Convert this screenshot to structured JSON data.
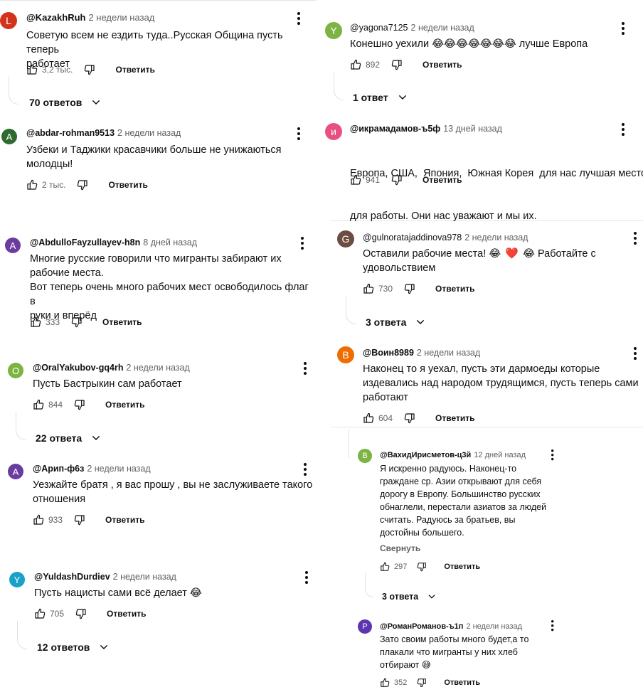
{
  "ui": {
    "reply_label": "Ответить",
    "collapse_label": "Свернуть"
  },
  "comments": [
    {
      "author": "@KazakhRuh",
      "time": "2 недели назад",
      "avatar": "L",
      "avatar_color": "#d2341b",
      "text_lines": [
        "Советую всем не ездить туда..Русская Община пусть теперь",
        "работает"
      ],
      "likes": "3,2 тыс.",
      "replies": "70 ответов"
    },
    {
      "author": "@abdar-rohman9513",
      "time": "2 недели назад",
      "avatar": "A",
      "avatar_color": "#2f6a31",
      "text_lines": [
        "Узбеки и Таджики красавчики больше не унижаються",
        "молодцы!"
      ],
      "likes": "2 тыс."
    },
    {
      "author": "@AbdulloFayzullayev-h8n",
      "time": "8 дней назад",
      "avatar": "A",
      "avatar_color": "#6a3ca0",
      "text_lines": [
        "Многие русские говорили что мигранты забирают их",
        "рабочие места.",
        "Вот теперь очень много рабочих мест освободилось флаг в",
        "руки и вперёд"
      ],
      "likes": "333"
    },
    {
      "author": "@OralYakubov-gq4rh",
      "time": "2 недели назад",
      "avatar": "O",
      "avatar_color": "#7cb342",
      "text_lines": [
        "Пусть Бастрыкин сам работает"
      ],
      "likes": "844",
      "replies": "22 ответа"
    },
    {
      "author": "@Арип-ф6з",
      "time": "2 недели назад",
      "avatar": "A",
      "avatar_color": "#6a3ca0",
      "text_lines": [
        "Уезжайте братя , я вас прошу , вы не заслуживаете такого",
        "отношения"
      ],
      "likes": "933"
    },
    {
      "author": "@YuldashDurdiev",
      "time": "2 недели назад",
      "avatar": "Y",
      "avatar_color": "#1aa1c7",
      "text_lines": [
        "Пусть нацисты сами всё делает"
      ],
      "emoji": [
        "😂"
      ],
      "likes": "705",
      "replies": "12 ответов"
    },
    {
      "author": "@yagona7125",
      "time": "2 недели назад",
      "avatar": "Y",
      "avatar_color": "#7cb342",
      "text_before_emoji": "Конешно уехили",
      "emoji": [
        "😂",
        "😂",
        "😂",
        "😂",
        "😂",
        "😂",
        "😂"
      ],
      "text_after_emoji": "лучше Европа",
      "likes": "892",
      "replies": "1 ответ"
    },
    {
      "author": "@икрамадамов-ъ5ф",
      "time": "13 дней назад",
      "avatar": "и",
      "avatar_color": "#e8517f",
      "text_lines": [
        "Европа, США,  Япония,  Южная Корея  для нас лучшая место",
        "для работы. Они нас уважают и мы их."
      ],
      "likes": "941"
    },
    {
      "author": "@gulnoratajaddinova978",
      "time": "2 недели назад",
      "avatar": "G",
      "avatar_color": "#6d4c41",
      "text_before_emoji": "Оставили рабочие места!",
      "emoji": [
        "😂",
        "❤️",
        "😂"
      ],
      "text_after_emoji": "Работайте с",
      "text_line2": "удовольствием",
      "likes": "730",
      "replies": "3 ответа"
    },
    {
      "author": "@Воин8989",
      "time": "2 недели назад",
      "avatar": "В",
      "avatar_color": "#ef6c00",
      "text_lines": [
        "Наконец то я уехал, пусть эти дармоеды которые",
        "издевались над народом трудящимся, пусть теперь сами",
        "работают"
      ],
      "likes": "604"
    },
    {
      "author": "@ВахидИрисметов-ц3й",
      "time": "12 дней назад",
      "avatar": "В",
      "avatar_color": "#7cb342",
      "text_lines": [
        "Я искренно радуюсь. Наконец-то",
        "граждане ср. Азии открывают для себя",
        "дорогу в Европу. Большинство русских",
        "обнаглели, перестали азиатов за людей",
        "считать. Радуюсь за братьев, вы",
        "достойны большего."
      ],
      "likes": "297",
      "replies": "3 ответа"
    },
    {
      "author": "@РоманРоманов-ъ1п",
      "time": "2 недели назад",
      "avatar": "Р",
      "avatar_color": "#5e35b1",
      "text_lines": [
        "Зато своим работы много будет,а то",
        "плакали что мигранты у них хлеб"
      ],
      "text_last_before_emoji": "отбирают",
      "emoji": [
        "😅"
      ],
      "likes": "352"
    }
  ]
}
